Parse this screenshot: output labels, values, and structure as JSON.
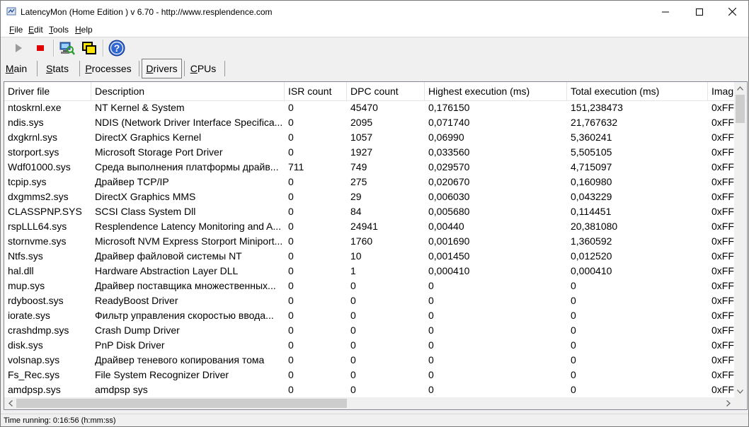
{
  "window": {
    "title": "LatencyMon  (Home Edition )  v 6.70 - http://www.resplendence.com"
  },
  "menu": [
    {
      "label": "File",
      "accel": "F"
    },
    {
      "label": "Edit",
      "accel": "E"
    },
    {
      "label": "Tools",
      "accel": "T"
    },
    {
      "label": "Help",
      "accel": "H"
    }
  ],
  "toolbar": {
    "buttons": [
      "play-icon",
      "stop-icon",
      "computer-search-icon",
      "windows-icon",
      "help-icon"
    ]
  },
  "tabs": [
    {
      "label": "Main",
      "active": false
    },
    {
      "label": "Stats",
      "active": false
    },
    {
      "label": "Processes",
      "active": false
    },
    {
      "label": "Drivers",
      "active": true
    },
    {
      "label": "CPUs",
      "active": false
    }
  ],
  "table": {
    "columns": [
      "Driver file",
      "Description",
      "ISR count",
      "DPC count",
      "Highest execution (ms)",
      "Total execution (ms)",
      "Imag"
    ],
    "rows": [
      [
        "ntoskrnl.exe",
        "NT Kernel & System",
        "0",
        "45470",
        "0,176150",
        "151,238473",
        "0xFF"
      ],
      [
        "ndis.sys",
        "NDIS (Network Driver Interface Specifica...",
        "0",
        "2095",
        "0,071740",
        "21,767632",
        "0xFF"
      ],
      [
        "dxgkrnl.sys",
        "DirectX Graphics Kernel",
        "0",
        "1057",
        "0,06990",
        "5,360241",
        "0xFF"
      ],
      [
        "storport.sys",
        "Microsoft Storage Port Driver",
        "0",
        "1927",
        "0,033560",
        "5,505105",
        "0xFF"
      ],
      [
        "Wdf01000.sys",
        "Среда выполнения платформы драйв...",
        "711",
        "749",
        "0,029570",
        "4,715097",
        "0xFF"
      ],
      [
        "tcpip.sys",
        "Драйвер TCP/IP",
        "0",
        "275",
        "0,020670",
        "0,160980",
        "0xFF"
      ],
      [
        "dxgmms2.sys",
        "DirectX Graphics MMS",
        "0",
        "29",
        "0,006030",
        "0,043229",
        "0xFF"
      ],
      [
        "CLASSPNP.SYS",
        "SCSI Class System Dll",
        "0",
        "84",
        "0,005680",
        "0,114451",
        "0xFF"
      ],
      [
        "rspLLL64.sys",
        "Resplendence Latency Monitoring and A...",
        "0",
        "24941",
        "0,00440",
        "20,381080",
        "0xFF"
      ],
      [
        "stornvme.sys",
        "Microsoft NVM Express Storport Miniport...",
        "0",
        "1760",
        "0,001690",
        "1,360592",
        "0xFF"
      ],
      [
        "Ntfs.sys",
        "Драйвер файловой системы NT",
        "0",
        "10",
        "0,001450",
        "0,012520",
        "0xFF"
      ],
      [
        "hal.dll",
        "Hardware Abstraction Layer DLL",
        "0",
        "1",
        "0,000410",
        "0,000410",
        "0xFF"
      ],
      [
        "mup.sys",
        "Драйвер поставщика множественных...",
        "0",
        "0",
        "0",
        "0",
        "0xFF"
      ],
      [
        "rdyboost.sys",
        "ReadyBoost Driver",
        "0",
        "0",
        "0",
        "0",
        "0xFF"
      ],
      [
        "iorate.sys",
        "Фильтр управления скоростью ввода...",
        "0",
        "0",
        "0",
        "0",
        "0xFF"
      ],
      [
        "crashdmp.sys",
        "Crash Dump Driver",
        "0",
        "0",
        "0",
        "0",
        "0xFF"
      ],
      [
        "disk.sys",
        "PnP Disk Driver",
        "0",
        "0",
        "0",
        "0",
        "0xFF"
      ],
      [
        "volsnap.sys",
        "Драйвер теневого копирования тома",
        "0",
        "0",
        "0",
        "0",
        "0xFF"
      ],
      [
        "Fs_Rec.sys",
        "File System Recognizer Driver",
        "0",
        "0",
        "0",
        "0",
        "0xFF"
      ],
      [
        "amdpsp.sys",
        "amdpsp sys",
        "0",
        "0",
        "0",
        "0",
        "0xFF"
      ]
    ]
  },
  "status": {
    "text": "Time running: 0:16:56  (h:mm:ss)"
  }
}
